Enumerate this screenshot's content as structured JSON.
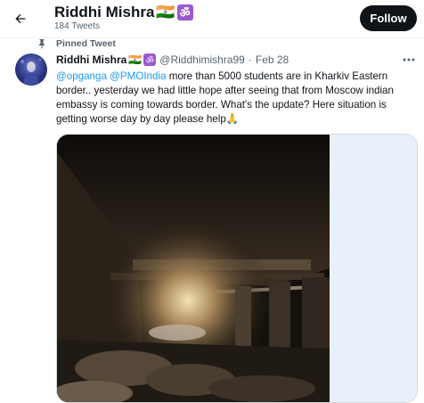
{
  "header": {
    "back_icon": "arrow-left-icon",
    "name": "Riddhi Mishra",
    "flag": "🇮🇳",
    "om_symbol": "ॐ",
    "tweet_count": "184 Tweets",
    "follow_label": "Follow"
  },
  "pinned_label": "Pinned Tweet",
  "tweet": {
    "name": "Riddhi Mishra",
    "flag": "🇮🇳",
    "om_symbol": "ॐ",
    "handle": "@Riddhimishra99",
    "separator": "·",
    "date": "Feb 28",
    "mention_1": "@opganga",
    "mention_2": "@PMOIndia",
    "text": " more than 5000 students are in Kharkiv Eastern border.. yesterday we had little hope after seeing that from Moscow indian embassy is coming towards border. What's the update? Here situation is getting worse day by day please help",
    "emoji": "🙏"
  },
  "colors": {
    "link": "#1d9bf0",
    "follow_bg": "#0f1419",
    "secondary_text": "#536471",
    "media_border": "#cfd9de"
  }
}
